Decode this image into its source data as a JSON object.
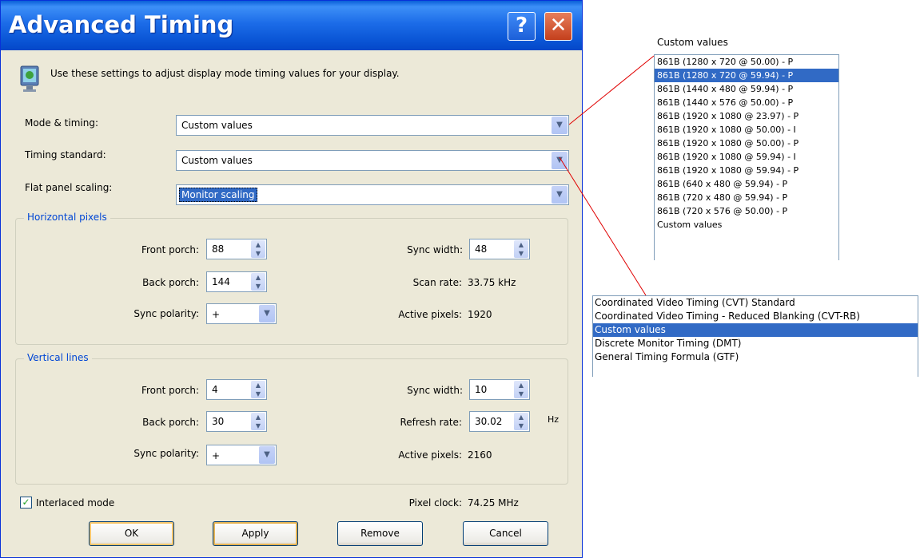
{
  "dialog": {
    "title": "Advanced Timing",
    "help_glyph": "?",
    "close_glyph": "✕",
    "intro": "Use these settings to adjust display mode timing values for your display."
  },
  "fields": {
    "mode_timing": {
      "label": "Mode & timing:",
      "value": "Custom values"
    },
    "timing_standard": {
      "label": "Timing standard:",
      "value": "Custom values"
    },
    "flat_panel": {
      "label": "Flat panel scaling:",
      "value": "Monitor scaling"
    }
  },
  "horizontal": {
    "title": "Horizontal pixels",
    "front_porch": {
      "label": "Front porch:",
      "value": "88"
    },
    "back_porch": {
      "label": "Back porch:",
      "value": "144"
    },
    "sync_polarity": {
      "label": "Sync polarity:",
      "value": "+"
    },
    "sync_width": {
      "label": "Sync width:",
      "value": "48"
    },
    "scan_rate": {
      "label": "Scan rate:",
      "value": "33.75 kHz"
    },
    "active_pixels": {
      "label": "Active pixels:",
      "value": "1920"
    }
  },
  "vertical": {
    "title": "Vertical lines",
    "front_porch": {
      "label": "Front porch:",
      "value": "4"
    },
    "back_porch": {
      "label": "Back porch:",
      "value": "30"
    },
    "sync_polarity": {
      "label": "Sync polarity:",
      "value": "+"
    },
    "sync_width": {
      "label": "Sync width:",
      "value": "10"
    },
    "refresh_rate": {
      "label": "Refresh rate:",
      "value": "30.02",
      "unit": "Hz"
    },
    "active_pixels": {
      "label": "Active pixels:",
      "value": "2160"
    }
  },
  "interlaced": {
    "label": "Interlaced mode",
    "checked": true
  },
  "pixel_clock": {
    "label": "Pixel clock:",
    "value": "74.25 MHz"
  },
  "buttons": {
    "ok": "OK",
    "apply": "Apply",
    "remove": "Remove",
    "cancel": "Cancel"
  },
  "mode_list": {
    "caption": "Custom values",
    "items": [
      "861B  (1280 x 720 @ 50.00) - P",
      "861B  (1280 x 720 @ 59.94) - P",
      "861B  (1440 x 480 @ 59.94) - P",
      "861B  (1440 x 576 @ 50.00) - P",
      "861B  (1920 x 1080 @ 23.97) - P",
      "861B  (1920 x 1080 @ 50.00) - I",
      "861B  (1920 x 1080 @ 50.00) - P",
      "861B  (1920 x 1080 @ 59.94) - I",
      "861B  (1920 x 1080 @ 59.94) - P",
      "861B  (640 x 480 @ 59.94) - P",
      "861B  (720 x 480 @ 59.94) - P",
      "861B  (720 x 576 @ 50.00) - P",
      "Custom values"
    ],
    "selected_index": 1
  },
  "standard_list": {
    "items": [
      "Coordinated Video Timing (CVT) Standard",
      "Coordinated Video Timing - Reduced Blanking (CVT-RB)",
      "Custom values",
      "Discrete Monitor Timing (DMT)",
      "General Timing Formula (GTF)"
    ],
    "selected_index": 2
  },
  "colors": {
    "selection": "#316ac5",
    "group_title": "#0046d5",
    "leader_line": "#e00000"
  },
  "icons": {
    "dropdown": "chevron-down-icon",
    "spinner": "spinner-arrows-icon",
    "display": "monitor-icon",
    "check": "checkmark-icon"
  }
}
